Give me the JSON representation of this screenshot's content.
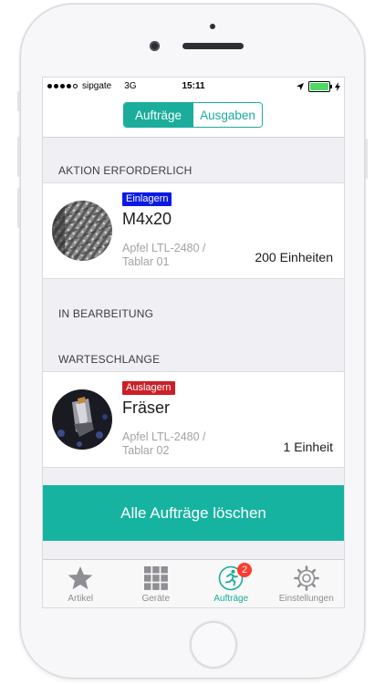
{
  "status_bar": {
    "carrier": "sipgate",
    "network": "3G",
    "time": "15:11"
  },
  "segmented_control": {
    "options": [
      "Aufträge",
      "Ausgaben"
    ],
    "selected": "Aufträge"
  },
  "sections": {
    "action_required": "AKTION ERFORDERLICH",
    "in_progress": "IN BEARBEITUNG",
    "queue": "WARTESCHLANGE"
  },
  "orders": [
    {
      "badge": "Einlagern",
      "badge_color": "#0a19e6",
      "title": "M4x20",
      "location_line1": "Apfel LTL-2480 /",
      "location_line2": "Tablar 01",
      "quantity": "200 Einheiten",
      "image": "screws-photo"
    },
    {
      "badge": "Auslagern",
      "badge_color": "#cc1f27",
      "title": "Fräser",
      "location_line1": "Apfel LTL-2480 /",
      "location_line2": "Tablar 02",
      "quantity": "1 Einheit",
      "image": "milling-cutter-photo"
    }
  ],
  "clear_button": "Alle Aufträge löschen",
  "tab_bar": {
    "items": [
      {
        "label": "Artikel",
        "icon": "star-icon"
      },
      {
        "label": "Geräte",
        "icon": "grid-icon"
      },
      {
        "label": "Aufträge",
        "icon": "runner-icon",
        "badge": "2"
      },
      {
        "label": "Einstellungen",
        "icon": "gear-icon"
      }
    ],
    "active": "Aufträge"
  },
  "colors": {
    "accent": "#1aad9b",
    "tab_badge": "#ff3b30",
    "battery": "#4cd964"
  }
}
